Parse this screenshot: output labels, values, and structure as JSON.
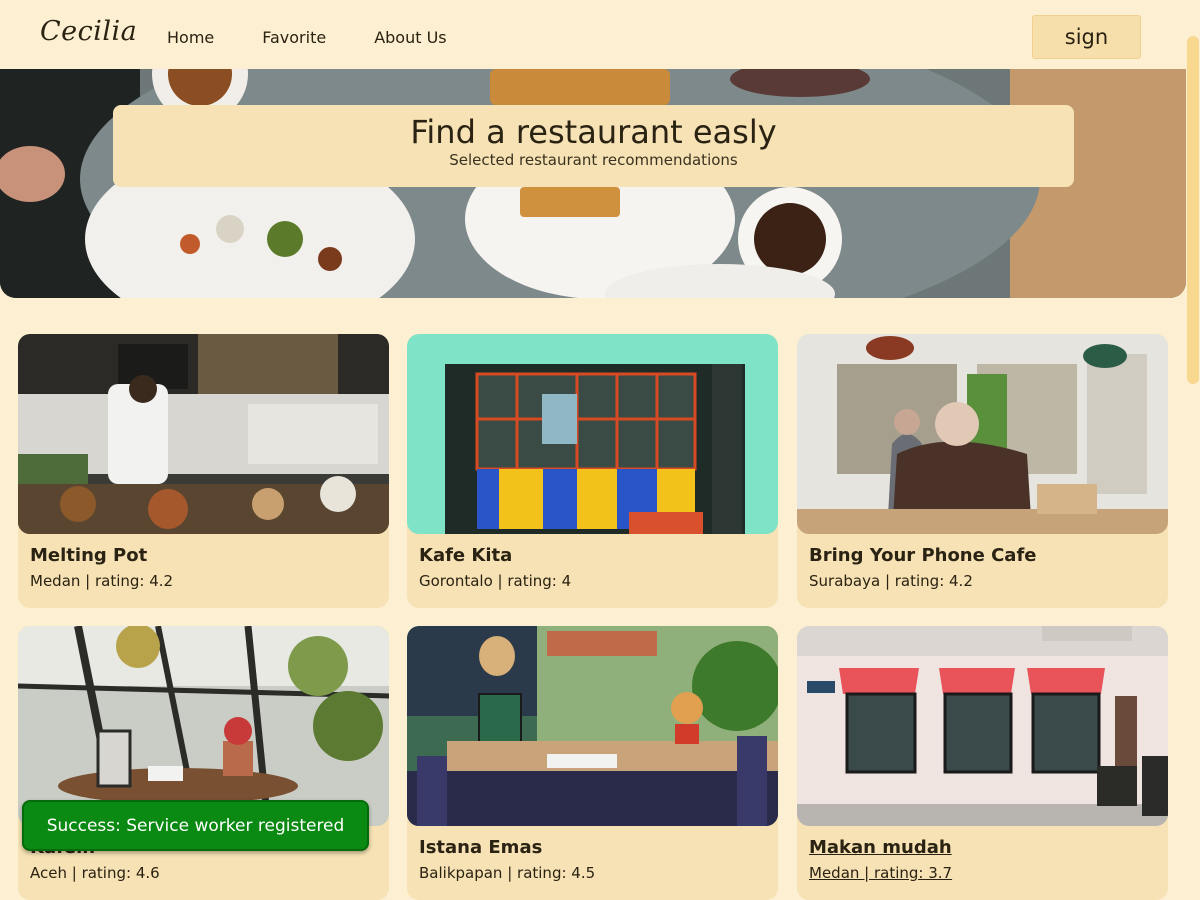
{
  "header": {
    "logo": "Cecilia",
    "nav": [
      {
        "label": "Home"
      },
      {
        "label": "Favorite"
      },
      {
        "label": "About Us"
      }
    ],
    "sign_label": "sign"
  },
  "hero": {
    "title": "Find a restaurant easly",
    "subtitle": "Selected restaurant recommendations"
  },
  "restaurants": [
    {
      "name": "Melting Pot",
      "meta": "Medan | rating: 4.2"
    },
    {
      "name": "Kafe Kita",
      "meta": "Gorontalo | rating: 4"
    },
    {
      "name": "Bring Your Phone Cafe",
      "meta": "Surabaya | rating: 4.2"
    },
    {
      "name": "Kafein",
      "meta": "Aceh | rating: 4.6"
    },
    {
      "name": "Istana Emas",
      "meta": "Balikpapan | rating: 4.5"
    },
    {
      "name": "Makan mudah",
      "meta": "Medan | rating: 3.7"
    }
  ],
  "toast": {
    "message": "Success: Service worker registered"
  },
  "colors": {
    "background": "#fdf0d2",
    "card": "#f6e2b4",
    "toast": "#0a8a12",
    "scroll_thumb": "#f8d88e"
  }
}
